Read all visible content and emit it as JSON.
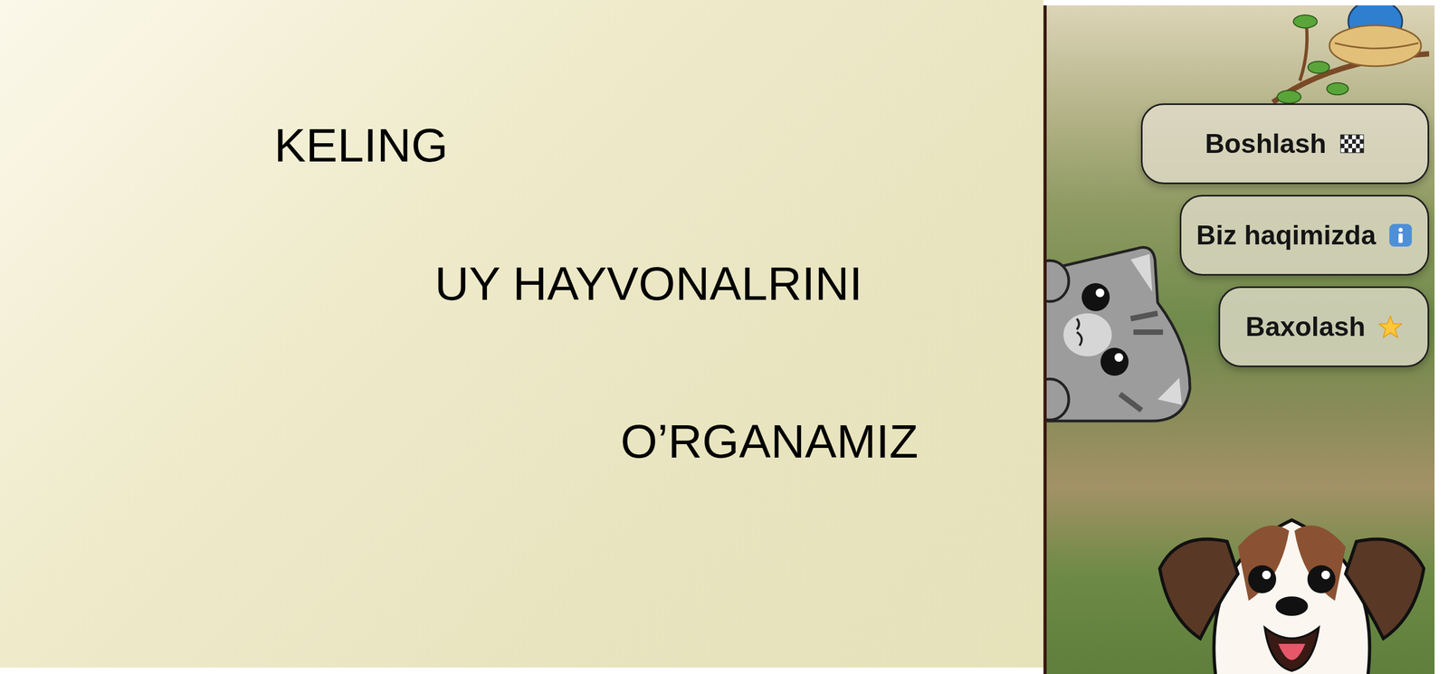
{
  "hero": {
    "lines": [
      "KELING",
      "UY HAYVONALRINI",
      "O’RGANAMIZ"
    ]
  },
  "menu": [
    {
      "label": "Boshlash",
      "kind": "flag"
    },
    {
      "label": "Biz haqimizda",
      "kind": "info"
    },
    {
      "label": "Baxolash",
      "kind": "star"
    }
  ]
}
